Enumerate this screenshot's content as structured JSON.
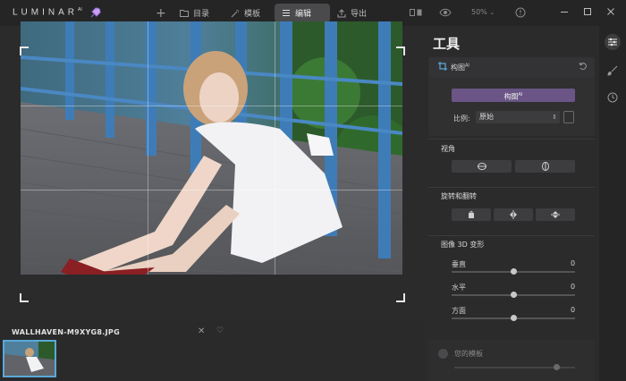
{
  "app": {
    "logo_text": "LUMINAR",
    "logo_sup": "AI"
  },
  "toolbar": {
    "add_label": "+",
    "catalog_label": "目录",
    "templates_label": "模板",
    "edit_label": "编辑",
    "export_label": "导出",
    "zoom_label": "50%"
  },
  "panel": {
    "title": "工具",
    "crop": {
      "header_label": "构图",
      "header_sup": "AI",
      "button_label": "构图",
      "button_sup": "AI",
      "ratio_label": "比例:",
      "ratio_value": "原始"
    },
    "perspective": {
      "label": "视角"
    },
    "rotate": {
      "label": "旋转和翻转"
    },
    "transform3d": {
      "label": "图像 3D 变形",
      "sliders": [
        {
          "label": "垂直",
          "value": "0",
          "position": 0.5
        },
        {
          "label": "水平",
          "value": "0",
          "position": 0.5
        },
        {
          "label": "方面",
          "value": "0",
          "position": 0.5
        }
      ]
    },
    "presets": {
      "label": "您的模板"
    }
  },
  "filmstrip": {
    "filename": "WALLHAVEN-M9XYG8.JPG"
  },
  "colors": {
    "accent": "#6a5586",
    "selection": "#5aa8d8"
  }
}
